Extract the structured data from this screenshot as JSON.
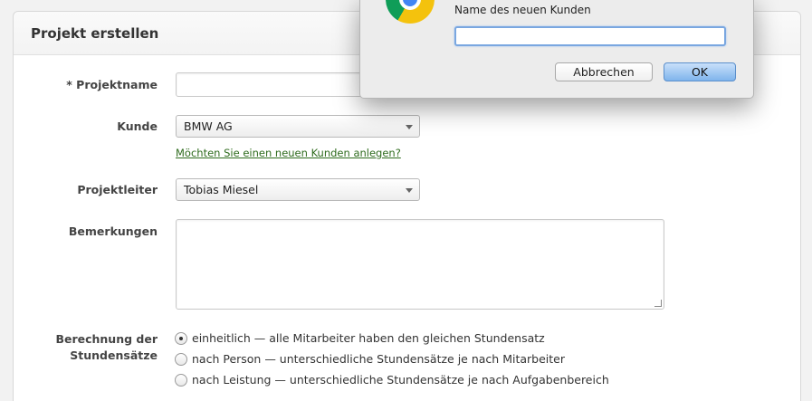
{
  "panel": {
    "title": "Projekt erstellen"
  },
  "form": {
    "project_name_label": "* Projektname",
    "project_name_value": "",
    "customer_label": "Kunde",
    "customer_selected": "BMW AG",
    "new_customer_link": "Möchten Sie einen neuen Kunden anlegen?",
    "project_lead_label": "Projektleiter",
    "project_lead_selected": "Tobias Miesel",
    "remarks_label": "Bemerkungen",
    "remarks_value": "",
    "rates_label_line1": "Berechnung der",
    "rates_label_line2": "Stundensätze",
    "rate_options": [
      {
        "label": "einheitlich — alle Mitarbeiter haben den gleichen Stundensatz",
        "checked": true
      },
      {
        "label": "nach Person — unterschiedliche Stundensätze je nach Mitarbeiter",
        "checked": false
      },
      {
        "label": "nach Leistung — unterschiedliche Stundensätze je nach Aufgabenbereich",
        "checked": false
      }
    ]
  },
  "dialog": {
    "icon": "chrome-logo-icon",
    "message": "Name des neuen Kunden",
    "input_value": "",
    "cancel_label": "Abbrechen",
    "ok_label": "OK"
  },
  "colors": {
    "link": "#2e6b1d",
    "ok_button": "#7fb4ec",
    "focus_ring": "#7aa7e0"
  }
}
